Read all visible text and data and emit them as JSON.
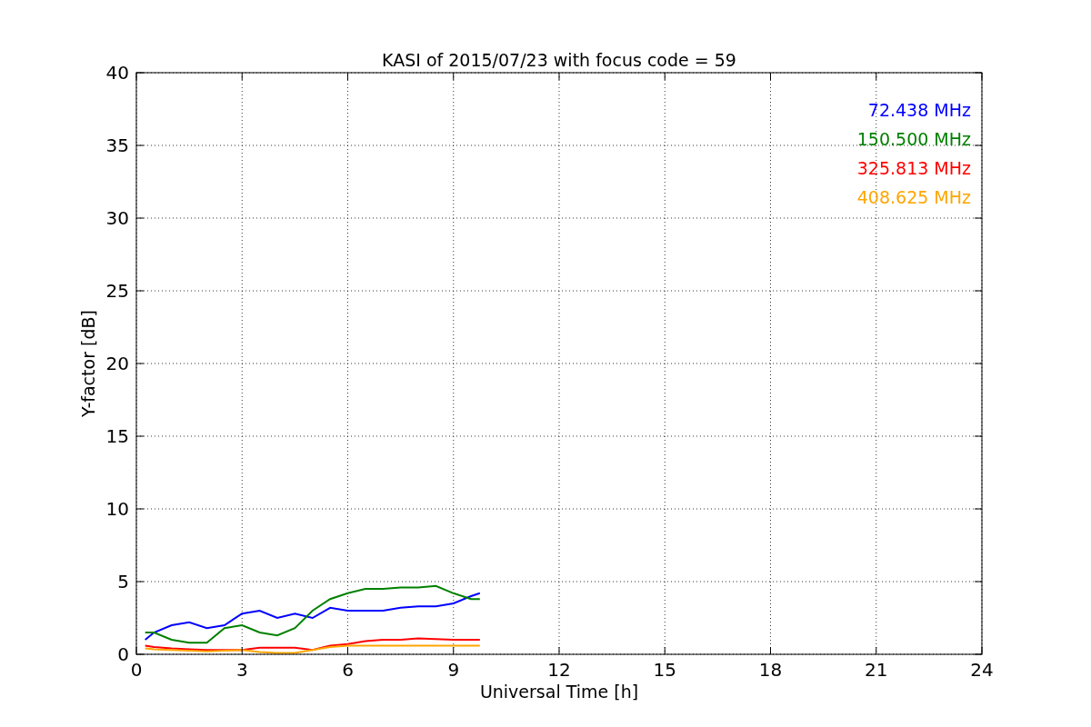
{
  "chart_data": {
    "type": "line",
    "title": "KASI of 2015/07/23 with focus code = 59",
    "xlabel": "Universal Time [h]",
    "ylabel": "Y-factor [dB]",
    "xlim": [
      0,
      24
    ],
    "ylim": [
      0,
      40
    ],
    "grid": true,
    "xticks": [
      0,
      3,
      6,
      9,
      12,
      15,
      18,
      21,
      24
    ],
    "yticks": [
      0,
      5,
      10,
      15,
      20,
      25,
      30,
      35,
      40
    ],
    "x": [
      0.25,
      0.5,
      1,
      1.5,
      2,
      2.5,
      3,
      3.5,
      4,
      4.5,
      5,
      5.5,
      6,
      6.5,
      7,
      7.5,
      8,
      8.5,
      9,
      9.5,
      9.75
    ],
    "series": [
      {
        "name": "72.438 MHz",
        "color": "#0000ff",
        "values": [
          1,
          1.5,
          2,
          2.2,
          1.8,
          2,
          2.8,
          3,
          2.5,
          2.8,
          2.5,
          3.2,
          3,
          3,
          3,
          3.2,
          3.3,
          3.3,
          3.5,
          4,
          4.2
        ]
      },
      {
        "name": "150.500 MHz",
        "color": "#008000",
        "values": [
          1.5,
          1.5,
          1,
          0.8,
          0.8,
          1.8,
          2,
          1.5,
          1.3,
          1.8,
          3,
          3.8,
          4.2,
          4.5,
          4.5,
          4.6,
          4.6,
          4.7,
          4.2,
          3.8,
          3.8
        ]
      },
      {
        "name": "325.813 MHz",
        "color": "#ff0000",
        "values": [
          0.6,
          0.5,
          0.4,
          0.35,
          0.3,
          0.3,
          0.3,
          0.45,
          0.45,
          0.45,
          0.3,
          0.6,
          0.7,
          0.9,
          1,
          1,
          1.1,
          1.05,
          1,
          1,
          1
        ]
      },
      {
        "name": "408.625 MHz",
        "color": "#ffa500",
        "values": [
          0.4,
          0.35,
          0.3,
          0.25,
          0.2,
          0.25,
          0.3,
          0.15,
          0.1,
          0.1,
          0.3,
          0.5,
          0.6,
          0.6,
          0.6,
          0.6,
          0.6,
          0.6,
          0.6,
          0.6,
          0.6
        ]
      }
    ]
  }
}
